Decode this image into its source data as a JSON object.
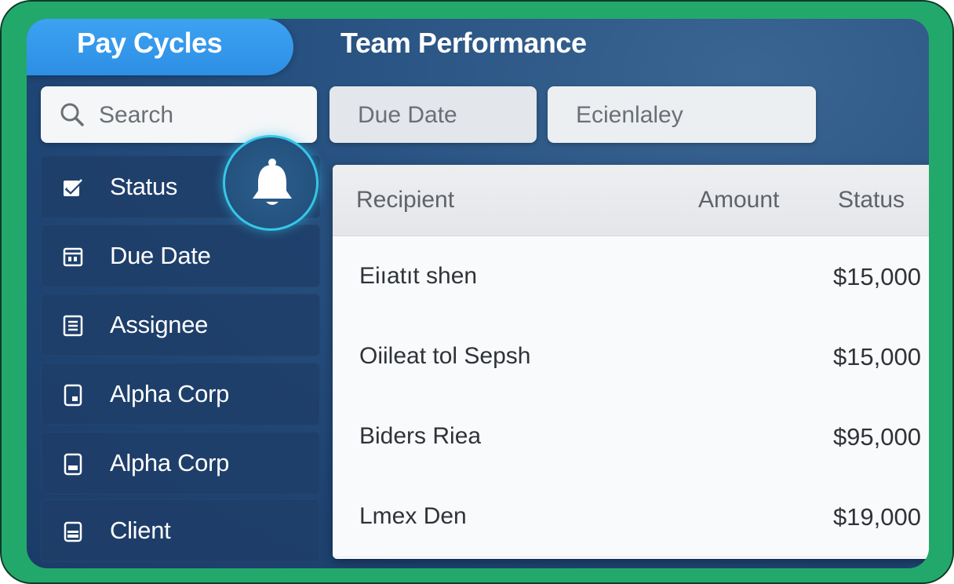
{
  "tabs": [
    {
      "label": "Pay Cycles",
      "active": true
    },
    {
      "label": "Team Performance",
      "active": false
    }
  ],
  "filters": {
    "search_placeholder": "Search",
    "due_date_label": "Due Date",
    "extra_label": "Ecienlaley"
  },
  "sidebar": {
    "items": [
      {
        "label": "Status",
        "icon": "checkbox-icon"
      },
      {
        "label": "Due Date",
        "icon": "calendar-icon"
      },
      {
        "label": "Assignee",
        "icon": "list-icon"
      },
      {
        "label": "Alpha Corp",
        "icon": "document-icon"
      },
      {
        "label": "Alpha Corp",
        "icon": "document-icon"
      },
      {
        "label": "Client",
        "icon": "card-icon"
      }
    ]
  },
  "notifications": {
    "icon": "bell-icon"
  },
  "table": {
    "headers": {
      "recipient": "Recipient",
      "amount": "Amount",
      "status": "Status"
    },
    "rows": [
      {
        "recipient": "Eiıatıt shen",
        "amount": "$15,000"
      },
      {
        "recipient": "Oiileat tol Sepsh",
        "amount": "$15,000"
      },
      {
        "recipient": "Biders Riea",
        "amount": "$95,000"
      },
      {
        "recipient": "Lmex Den",
        "amount": "$19,000"
      }
    ]
  },
  "colors": {
    "frame": "#23a86b",
    "active_tab": "#2d8fe4",
    "bell_ring": "#35c7e8",
    "background": "#1f4574"
  }
}
